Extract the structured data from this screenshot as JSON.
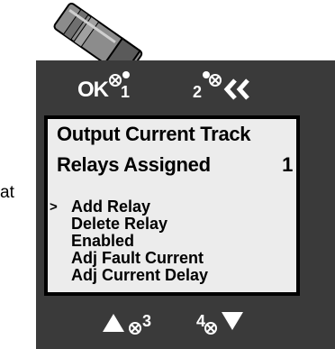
{
  "cut_off_text": "at",
  "top_buttons": {
    "ok": {
      "label": "OK",
      "number": "1",
      "icon": "ok-led-icon"
    },
    "back": {
      "number": "2",
      "label": "<<",
      "icon": "back-led-icon"
    }
  },
  "screen": {
    "title": "Output Current Track",
    "relays_label": "Relays Assigned",
    "relays_count": "1",
    "cursor": ">",
    "menu_items": [
      {
        "label": "Add Relay",
        "selected": true
      },
      {
        "label": "Delete Relay",
        "selected": false
      },
      {
        "label": "Enabled",
        "selected": false
      },
      {
        "label": "Adj Fault Current",
        "selected": false
      },
      {
        "label": "Adj Current Delay",
        "selected": false
      }
    ]
  },
  "bottom_buttons": {
    "up": {
      "number": "3",
      "icon": "up-arrow-icon"
    },
    "down": {
      "number": "4",
      "icon": "down-arrow-icon"
    }
  },
  "colors": {
    "panel": "#3a3a3a",
    "screen_bg": "#ececec",
    "text_light": "#ffffff",
    "probe_body": "#8c8c8c"
  }
}
